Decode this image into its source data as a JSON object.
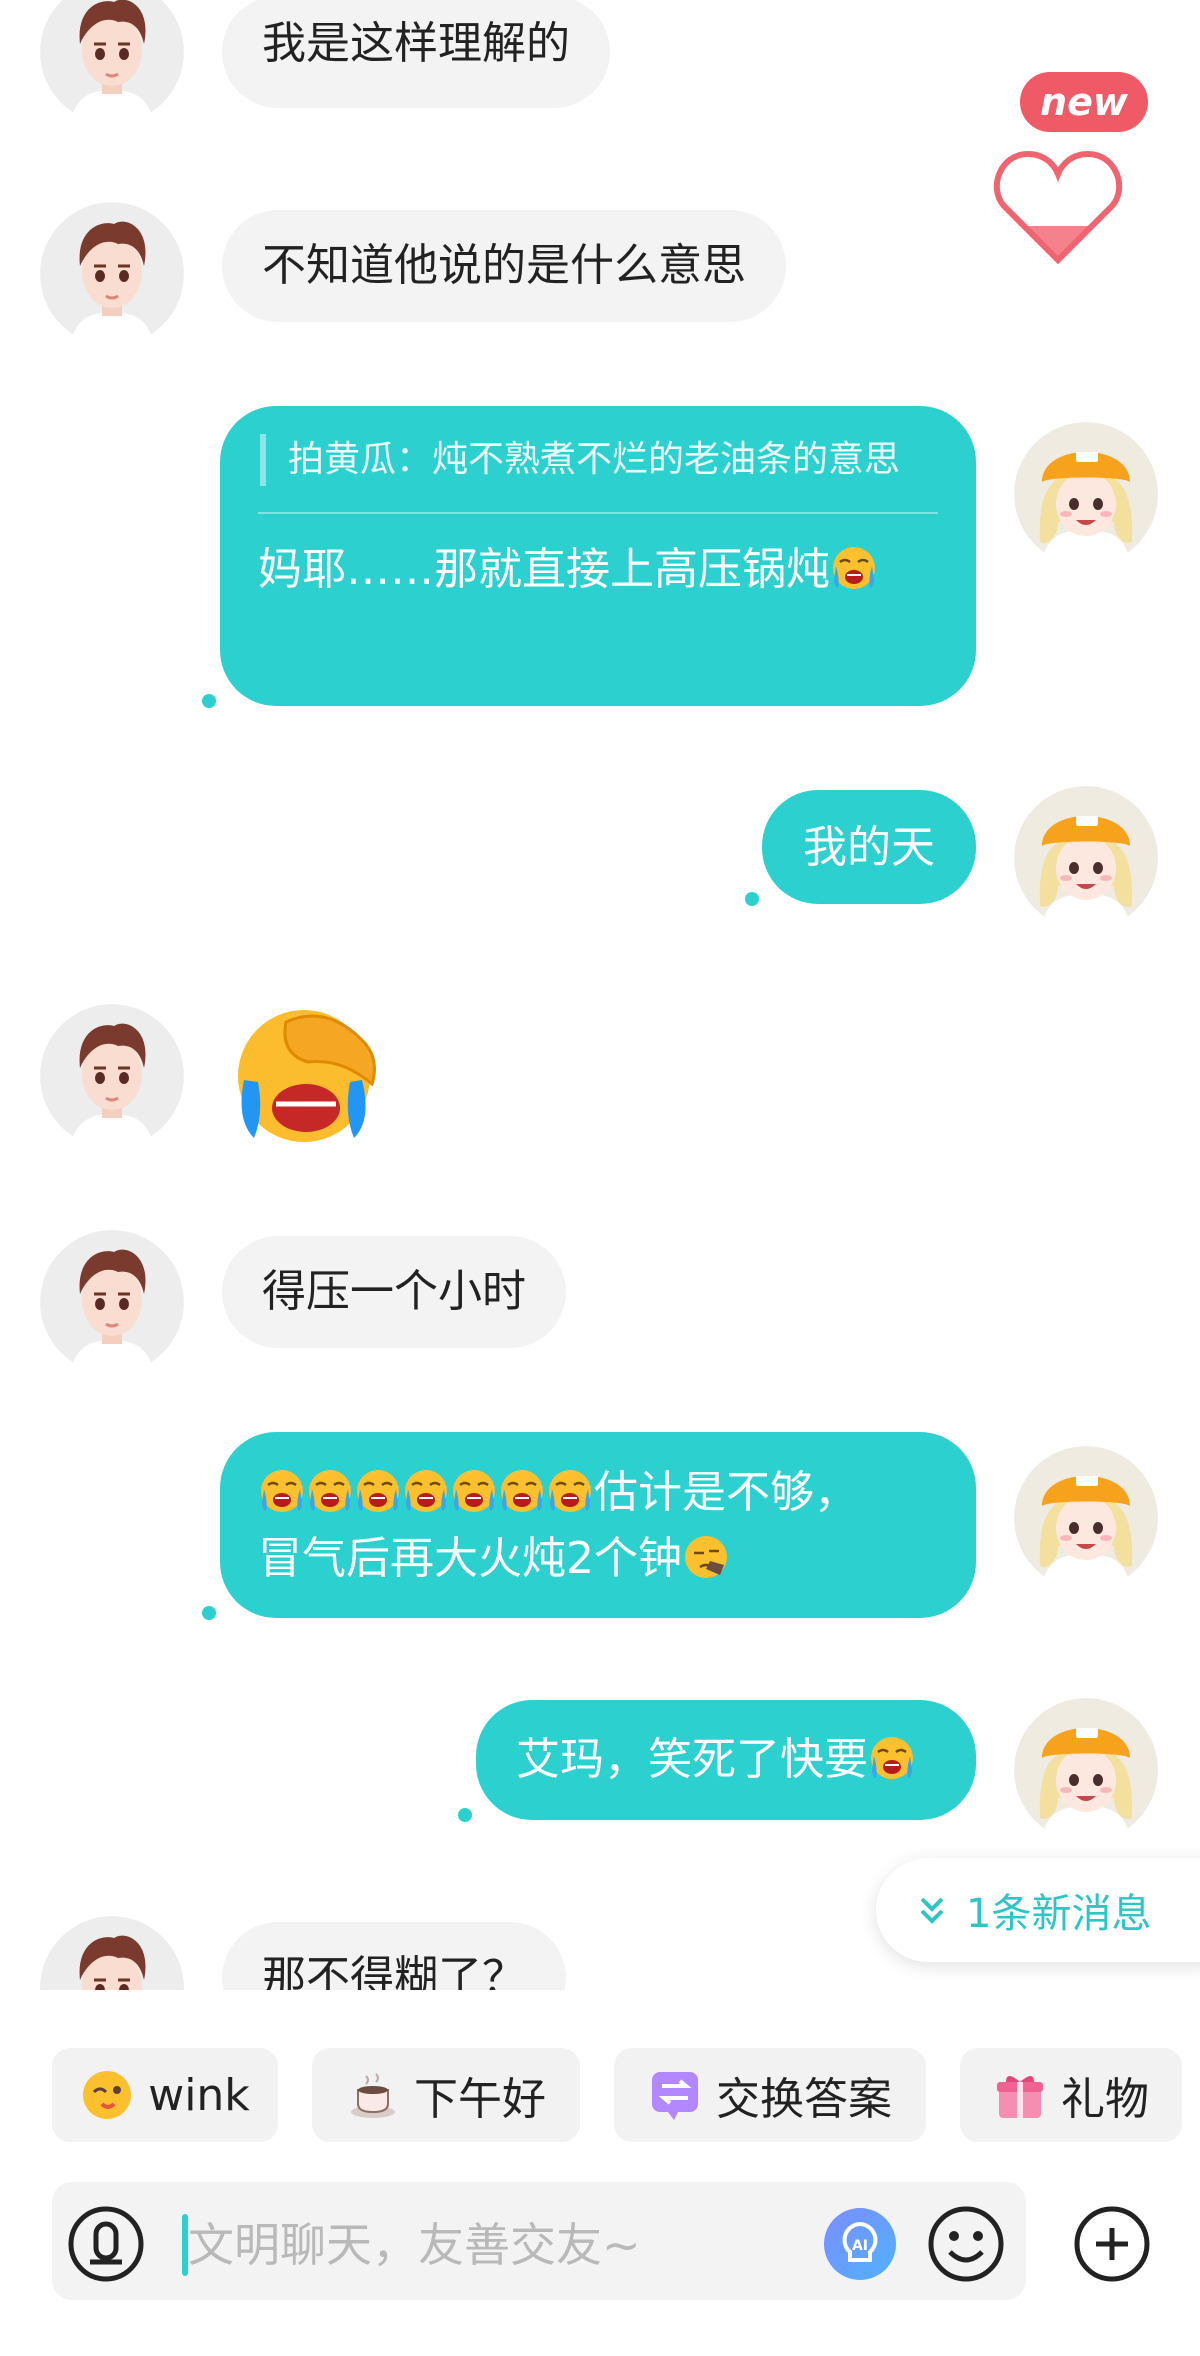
{
  "messages": {
    "m1": "我是这样理解的",
    "m2": "不知道他说的是什么意思",
    "m3_quote": "拍黄瓜：炖不熟煮不烂的老油条的意思",
    "m3_text": "妈耶……那就直接上高压锅炖",
    "m4": "我的天",
    "m6": "得压一个小时",
    "m7_line1": "估计是不够，",
    "m7_line2": "冒气后再大火炖2个钟",
    "m8": "艾玛，笑死了快要",
    "m9": "那不得糊了？"
  },
  "badge": {
    "new": "new"
  },
  "new_messages": {
    "label": "1条新消息"
  },
  "quick_actions": [
    {
      "label": "wink",
      "icon": "wink-face-icon"
    },
    {
      "label": "下午好",
      "icon": "coffee-cup-icon"
    },
    {
      "label": "交换答案",
      "icon": "exchange-icon"
    },
    {
      "label": "礼物",
      "icon": "gift-icon"
    }
  ],
  "input": {
    "placeholder": "文明聊天，友善交友~"
  },
  "colors": {
    "accent": "#2cd1cf",
    "incoming_bubble": "#f3f3f3",
    "heart": "#f0606e"
  }
}
